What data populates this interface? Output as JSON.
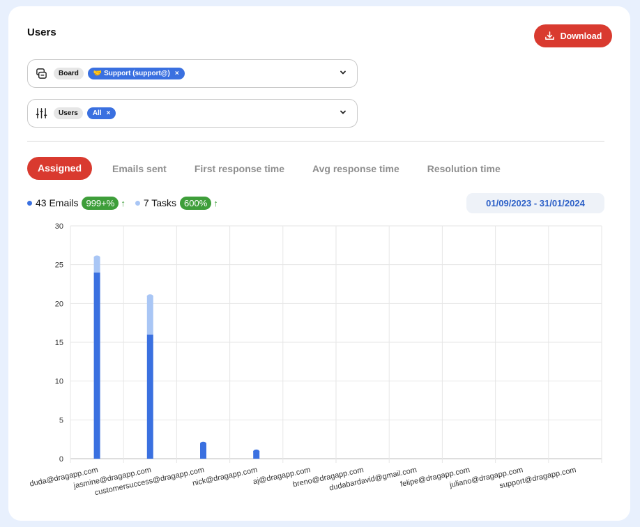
{
  "page": {
    "title": "Users",
    "download_label": "Download",
    "download_icon": "download-icon"
  },
  "filters": [
    {
      "icon": "board-icon",
      "label": "Board",
      "chip": "🤝 Support (support@)",
      "remove": "×"
    },
    {
      "icon": "sliders-icon",
      "label": "Users",
      "chip": "All",
      "remove": "×"
    }
  ],
  "tabs": [
    {
      "label": "Assigned",
      "active": true
    },
    {
      "label": "Emails sent",
      "active": false
    },
    {
      "label": "First response time",
      "active": false
    },
    {
      "label": "Avg response time",
      "active": false
    },
    {
      "label": "Resolution time",
      "active": false
    }
  ],
  "summary": {
    "emails_text": "43 Emails",
    "emails_change": "999+%",
    "tasks_text": "7 Tasks",
    "tasks_change": "600%",
    "arrow": "↑",
    "date_range": "01/09/2023 - 31/01/2024"
  },
  "colors": {
    "accent": "#d93a2f",
    "emails": "#3a70e0",
    "tasks": "#a9c6f5",
    "positive": "#3e9e3a",
    "date": "#2b5fc7"
  },
  "chart_data": {
    "type": "bar",
    "stacked": true,
    "categories": [
      "duda@dragapp.com",
      "jasmine@dragapp.com",
      "customersuccess@dragapp.com",
      "nick@dragapp.com",
      "aj@dragapp.com",
      "breno@dragapp.com",
      "dudabardavid@gmail.com",
      "felipe@dragapp.com",
      "juliano@dragapp.com",
      "support@dragapp.com"
    ],
    "series": [
      {
        "name": "Emails",
        "values": [
          24,
          16,
          2,
          1,
          0,
          0,
          0,
          0,
          0,
          0
        ]
      },
      {
        "name": "Tasks",
        "values": [
          2,
          5,
          0,
          0,
          0,
          0,
          0,
          0,
          0,
          0
        ]
      }
    ],
    "yticks": [
      0,
      5,
      10,
      15,
      20,
      25,
      30
    ],
    "ylim": [
      0,
      30
    ],
    "grid": true
  }
}
